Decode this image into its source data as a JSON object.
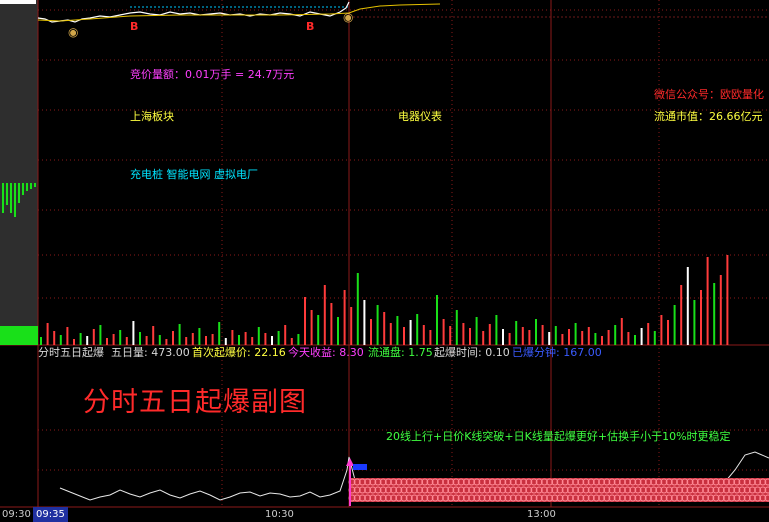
{
  "colors": {
    "grid": "#8b1a1a",
    "price_line": "#ffffff",
    "avg_line": "#e6c200",
    "up_bar": "#ff3b3b",
    "down_bar": "#19e019",
    "dashed": "#00c8ff",
    "signal": "#ff4fa0"
  },
  "top_panel": {
    "bid_amount": "竞价量额：0.01万手 = 24.7万元",
    "wechat": "微信公众号：欧欧量化",
    "sector_left": "上海板块",
    "sector_mid": "电器仪表",
    "market_cap": "流通市值：26.66亿元",
    "concepts": "充电桩 智能电网 虚拟电厂",
    "buy_marks": [
      "B",
      "B"
    ],
    "coin_icons": [
      "money-bag-icon",
      "money-bag-icon"
    ]
  },
  "indicator_header": {
    "name": "分时五日起爆",
    "five_day_vol": "五日量: 473.00",
    "first_burst_price": "首次起爆价: 22.16",
    "today_gain": "今天收益: 8.30",
    "float_shares": "流通盘: 1.75",
    "burst_time": "起爆时间: 0.10",
    "burst_minutes": "已爆分钟: 167.00"
  },
  "subchart": {
    "title": "分时五日起爆副图",
    "rule_text": "20线上行+日价K线突破+日K线量起爆更好+估换手小于10%时更稳定"
  },
  "time_axis": {
    "start": "09:30",
    "cursor": "09:35",
    "t1": "10:30",
    "t2": "13:00"
  }
}
